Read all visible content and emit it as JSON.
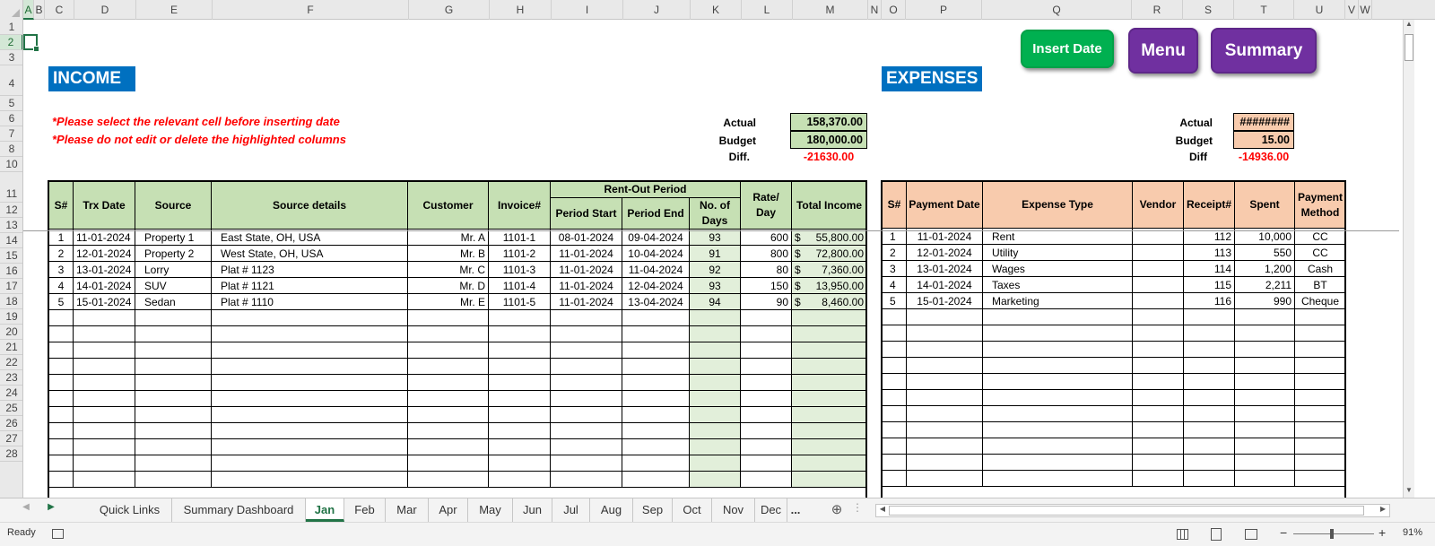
{
  "columns": [
    "A",
    "B",
    "C",
    "D",
    "E",
    "F",
    "G",
    "H",
    "I",
    "J",
    "K",
    "L",
    "M",
    "N",
    "O",
    "P",
    "Q",
    "R",
    "S",
    "T",
    "U",
    "V",
    "W"
  ],
  "rows": [
    "1",
    "2",
    "3",
    "4",
    "5",
    "6",
    "7",
    "8",
    "10",
    "11",
    "12",
    "13",
    "14",
    "15",
    "16",
    "17",
    "18",
    "19",
    "20",
    "21",
    "22",
    "23",
    "24",
    "25",
    "26",
    "27",
    "28"
  ],
  "buttons": {
    "insert_date": "Insert Date",
    "menu": "Menu",
    "summary": "Summary"
  },
  "income": {
    "title": "INCOME",
    "notes": [
      "*Please select the relevant cell before inserting date",
      "*Please do not edit or delete the highlighted columns"
    ],
    "kpi": {
      "actual_label": "Actual",
      "actual": "158,370.00",
      "budget_label": "Budget",
      "budget": "180,000.00",
      "diff_label": "Diff.",
      "diff": "-21630.00"
    },
    "headers": {
      "sno": "S#",
      "trx_date": "Trx Date",
      "source": "Source",
      "source_details": "Source details",
      "customer": "Customer",
      "invoice": "Invoice#",
      "rent_out": "Rent-Out Period",
      "period_start": "Period Start",
      "period_end": "Period End",
      "days": "No. of Days",
      "rate": "Rate/ Day",
      "total": "Total Income"
    },
    "currency": "$",
    "rows": [
      {
        "sno": "1",
        "date": "11-01-2024",
        "source": "Property 1",
        "details": "East State, OH, USA",
        "customer": "Mr. A",
        "invoice": "1101-1",
        "start": "08-01-2024",
        "end": "09-04-2024",
        "days": "93",
        "rate": "600",
        "total": "55,800.00"
      },
      {
        "sno": "2",
        "date": "12-01-2024",
        "source": "Property 2",
        "details": "West State, OH, USA",
        "customer": "Mr. B",
        "invoice": "1101-2",
        "start": "11-01-2024",
        "end": "10-04-2024",
        "days": "91",
        "rate": "800",
        "total": "72,800.00"
      },
      {
        "sno": "3",
        "date": "13-01-2024",
        "source": "Lorry",
        "details": "Plat # 1123",
        "customer": "Mr. C",
        "invoice": "1101-3",
        "start": "11-01-2024",
        "end": "11-04-2024",
        "days": "92",
        "rate": "80",
        "total": "7,360.00"
      },
      {
        "sno": "4",
        "date": "14-01-2024",
        "source": "SUV",
        "details": "Plat # 1121",
        "customer": "Mr. D",
        "invoice": "1101-4",
        "start": "11-01-2024",
        "end": "12-04-2024",
        "days": "93",
        "rate": "150",
        "total": "13,950.00"
      },
      {
        "sno": "5",
        "date": "15-01-2024",
        "source": "Sedan",
        "details": "Plat # 1110",
        "customer": "Mr. E",
        "invoice": "1101-5",
        "start": "11-01-2024",
        "end": "13-04-2024",
        "days": "94",
        "rate": "90",
        "total": "8,460.00"
      }
    ]
  },
  "expenses": {
    "title": "EXPENSES",
    "kpi": {
      "actual_label": "Actual",
      "actual": "########",
      "budget_label": "Budget",
      "budget": "15.00",
      "diff_label": "Diff",
      "diff": "-14936.00"
    },
    "headers": {
      "sno": "S#",
      "payment_date": "Payment Date",
      "expense_type": "Expense Type",
      "vendor": "Vendor",
      "receipt": "Receipt#",
      "spent": "Spent",
      "method": "Payment Method"
    },
    "rows": [
      {
        "sno": "1",
        "date": "11-01-2024",
        "type": "Rent",
        "vendor": "",
        "receipt": "112",
        "spent": "10,000",
        "method": "CC"
      },
      {
        "sno": "2",
        "date": "12-01-2024",
        "type": "Utility",
        "vendor": "",
        "receipt": "113",
        "spent": "550",
        "method": "CC"
      },
      {
        "sno": "3",
        "date": "13-01-2024",
        "type": "Wages",
        "vendor": "",
        "receipt": "114",
        "spent": "1,200",
        "method": "Cash"
      },
      {
        "sno": "4",
        "date": "14-01-2024",
        "type": "Taxes",
        "vendor": "",
        "receipt": "115",
        "spent": "2,211",
        "method": "BT"
      },
      {
        "sno": "5",
        "date": "15-01-2024",
        "type": "Marketing",
        "vendor": "",
        "receipt": "116",
        "spent": "990",
        "method": "Cheque"
      }
    ]
  },
  "tabs": [
    "Quick Links",
    "Summary Dashboard",
    "Jan",
    "Feb",
    "Mar",
    "Apr",
    "May",
    "Jun",
    "Jul",
    "Aug",
    "Sep",
    "Oct",
    "Nov",
    "Dec"
  ],
  "active_tab": "Jan",
  "tab_more": "...",
  "status": {
    "ready": "Ready",
    "zoom": "91%"
  },
  "colors": {
    "excel_green": "#217346",
    "income_header": "#c6e0b4",
    "expense_header": "#f8cbad",
    "band": "#0070c0",
    "button_green": "#00b050",
    "button_purple": "#7030a0",
    "highlight": "#e2efda"
  }
}
